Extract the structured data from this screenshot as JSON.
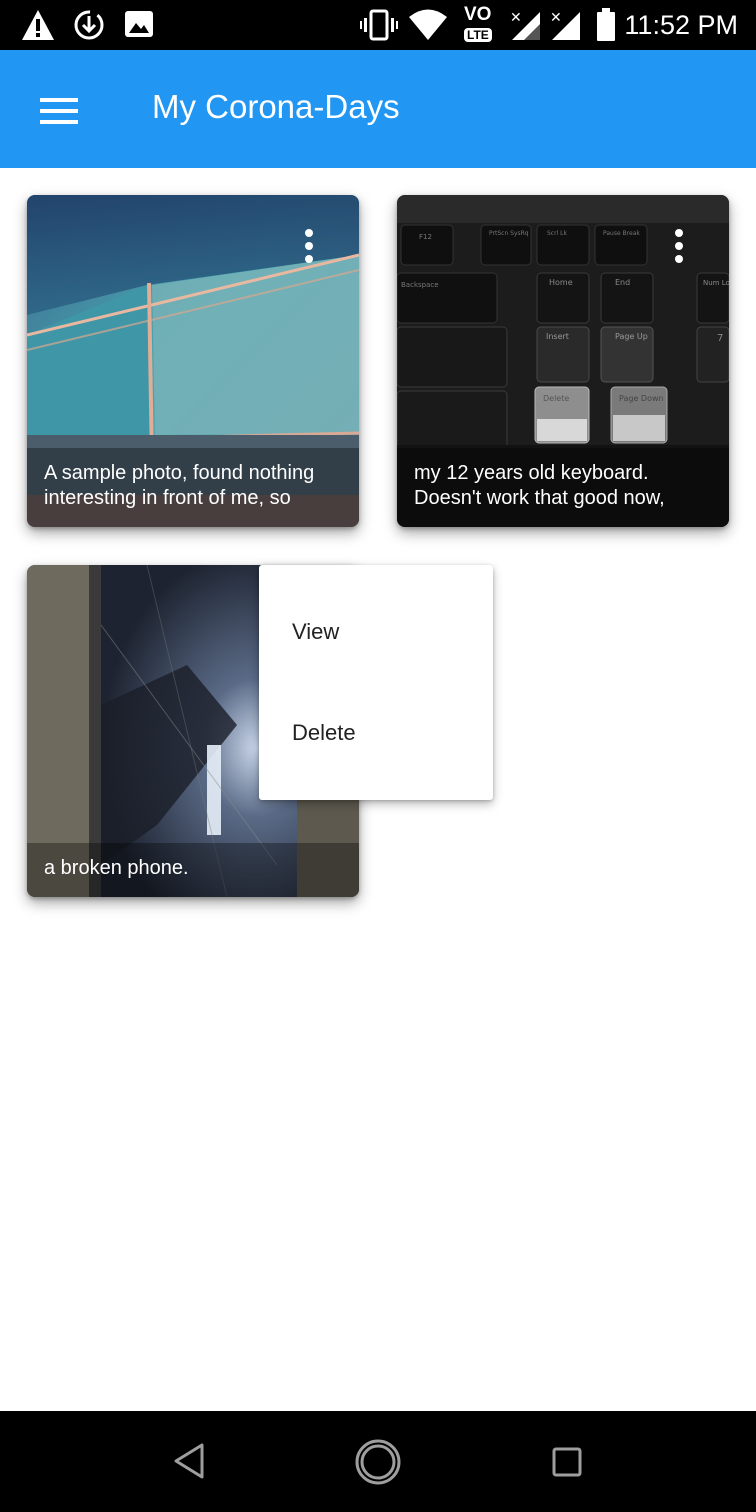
{
  "status_bar": {
    "time": "11:52 PM",
    "left_icons": [
      "warning-icon",
      "download-icon",
      "image-icon"
    ],
    "right_icons": [
      "vibrate-icon",
      "wifi-icon",
      "volte-icon",
      "signal-icon",
      "signal-icon",
      "battery-icon"
    ],
    "volte_text": "VO",
    "lte_text": "LTE"
  },
  "app_bar": {
    "title": "My Corona-Days",
    "menu_icon": "hamburger-menu-icon",
    "color": "#2196f3"
  },
  "cards": [
    {
      "caption": "A sample photo, found nothing\ninteresting in front of me, so",
      "has_menu": true
    },
    {
      "caption": "my 12 years old keyboard.\nDoesn't work that good now,",
      "has_menu": true
    },
    {
      "caption": "a broken phone.",
      "has_menu": false
    }
  ],
  "keyboard_keys": [
    "F12",
    "PrtScn SysRq",
    "Scrl Lk",
    "Pause Break",
    "Backspace",
    "Home",
    "End",
    "Num Lock",
    "Insert",
    "Page Up",
    "Delete",
    "Page Down",
    "7"
  ],
  "popup_menu": {
    "items": [
      {
        "label": "View"
      },
      {
        "label": "Delete"
      }
    ]
  },
  "nav_bar": {
    "buttons": [
      "back-icon",
      "home-icon",
      "recents-icon"
    ]
  }
}
